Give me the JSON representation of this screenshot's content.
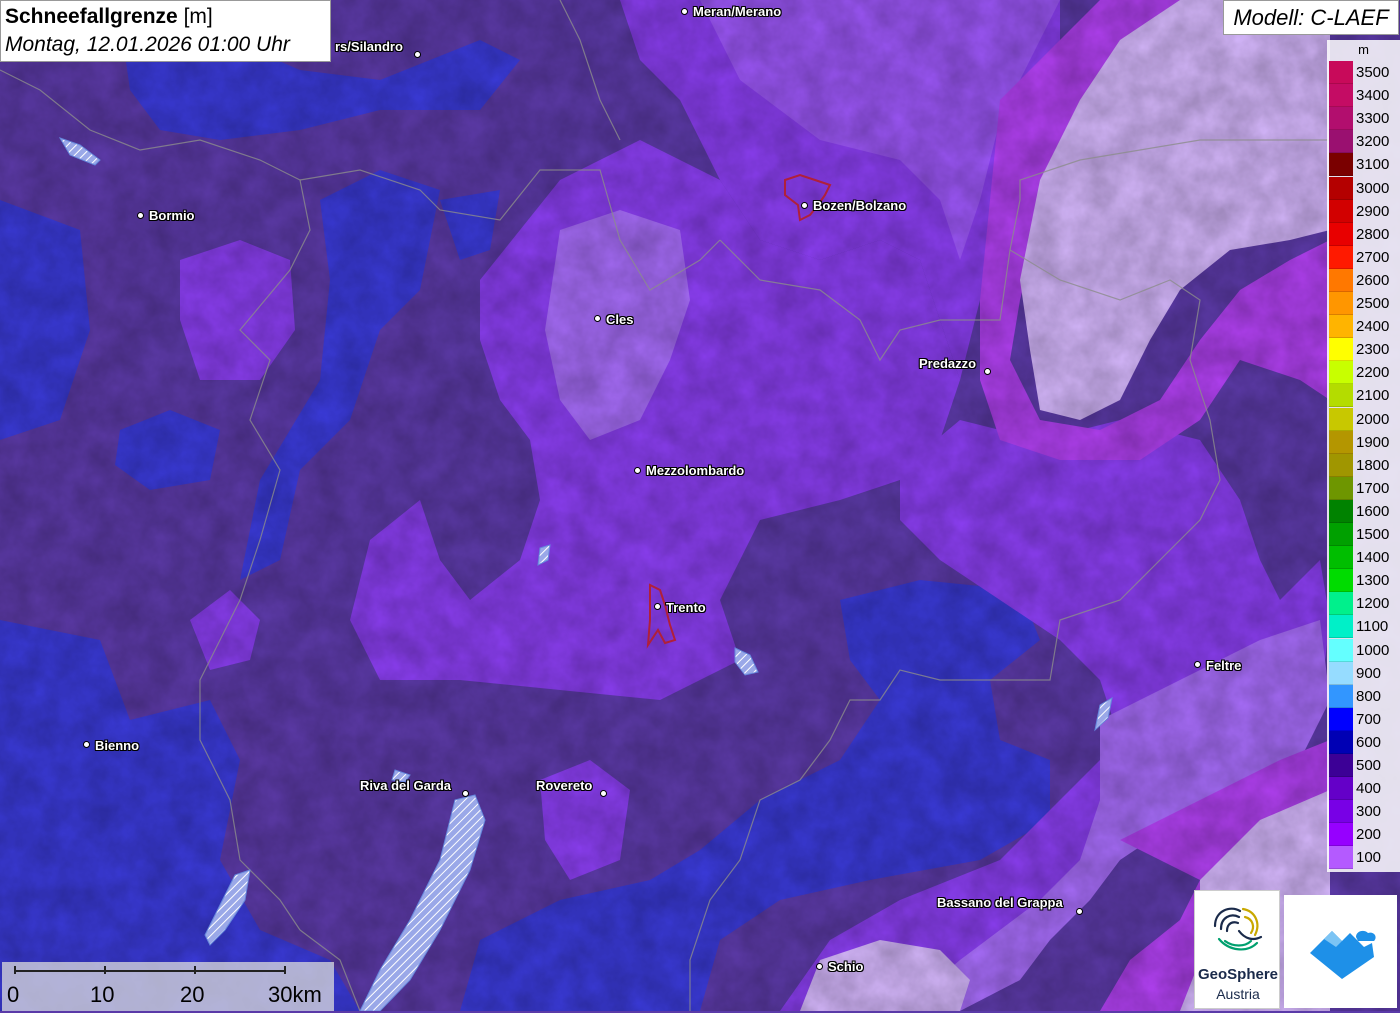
{
  "title": {
    "main": "Schneefallgrenze",
    "unit": "[m]",
    "datetime": "Montag, 12.01.2026 01:00 Uhr"
  },
  "model": "Modell: C-LAEF",
  "legend": {
    "unit": "m",
    "entries": [
      {
        "label": "3500",
        "color": "#c80a5a"
      },
      {
        "label": "3400",
        "color": "#c40c64"
      },
      {
        "label": "3300",
        "color": "#b20e6e"
      },
      {
        "label": "3200",
        "color": "#9a1070"
      },
      {
        "label": "3100",
        "color": "#7a0000"
      },
      {
        "label": "3000",
        "color": "#b40000"
      },
      {
        "label": "2900",
        "color": "#d20000"
      },
      {
        "label": "2800",
        "color": "#e80000"
      },
      {
        "label": "2700",
        "color": "#ff1a00"
      },
      {
        "label": "2600",
        "color": "#ff7800"
      },
      {
        "label": "2500",
        "color": "#ff9600"
      },
      {
        "label": "2400",
        "color": "#ffb400"
      },
      {
        "label": "2300",
        "color": "#ffff00"
      },
      {
        "label": "2200",
        "color": "#c8ff00"
      },
      {
        "label": "2100",
        "color": "#b4dc00"
      },
      {
        "label": "2000",
        "color": "#c8c800"
      },
      {
        "label": "1900",
        "color": "#b49600"
      },
      {
        "label": "1800",
        "color": "#a09600"
      },
      {
        "label": "1700",
        "color": "#6e9600"
      },
      {
        "label": "1600",
        "color": "#008200"
      },
      {
        "label": "1500",
        "color": "#00a000"
      },
      {
        "label": "1400",
        "color": "#00be00"
      },
      {
        "label": "1300",
        "color": "#00dc00"
      },
      {
        "label": "1200",
        "color": "#00f08c"
      },
      {
        "label": "1100",
        "color": "#00f0c8"
      },
      {
        "label": "1000",
        "color": "#64ffff"
      },
      {
        "label": "900",
        "color": "#96dcff"
      },
      {
        "label": "800",
        "color": "#3296ff"
      },
      {
        "label": "700",
        "color": "#0000ff"
      },
      {
        "label": "600",
        "color": "#0000b4"
      },
      {
        "label": "500",
        "color": "#3c0096"
      },
      {
        "label": "400",
        "color": "#6400c8"
      },
      {
        "label": "300",
        "color": "#7800e6"
      },
      {
        "label": "200",
        "color": "#9600ff"
      },
      {
        "label": "100",
        "color": "#b45aff"
      }
    ]
  },
  "cities": [
    {
      "name": "Meran/Merano"
    },
    {
      "name": "rs/Silandro"
    },
    {
      "name": "Bormio"
    },
    {
      "name": "Bozen/Bolzano"
    },
    {
      "name": "Cles"
    },
    {
      "name": "Predazzo"
    },
    {
      "name": "Mezzolombardo"
    },
    {
      "name": "Trento"
    },
    {
      "name": "Feltre"
    },
    {
      "name": "Bienno"
    },
    {
      "name": "Riva del Garda"
    },
    {
      "name": "Rovereto"
    },
    {
      "name": "Bassano del Grappa"
    },
    {
      "name": "Schio"
    }
  ],
  "scale_bar": {
    "labels": [
      "0",
      "10",
      "20",
      "30km"
    ]
  },
  "logos": {
    "geosphere_line1": "GeoSphere",
    "geosphere_line2": "Austria"
  }
}
